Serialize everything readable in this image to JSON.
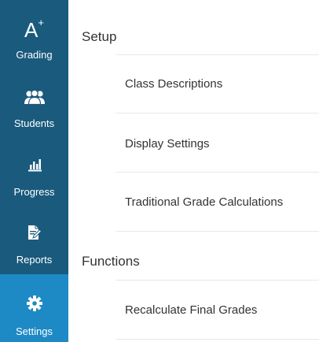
{
  "sidebar": {
    "items": [
      {
        "label": "Grading",
        "icon": "a-plus-icon",
        "active": false
      },
      {
        "label": "Students",
        "icon": "students-icon",
        "active": false
      },
      {
        "label": "Progress",
        "icon": "bar-chart-icon",
        "active": false
      },
      {
        "label": "Reports",
        "icon": "report-edit-icon",
        "active": false
      },
      {
        "label": "Settings",
        "icon": "gear-icon",
        "active": true
      }
    ],
    "grading_icon_glyph": "A",
    "grading_icon_sup": "+"
  },
  "sections": [
    {
      "title": "Setup",
      "items": [
        "Class Descriptions",
        "Display Settings",
        "Traditional Grade Calculations"
      ]
    },
    {
      "title": "Functions",
      "items": [
        "Recalculate Final Grades"
      ]
    }
  ],
  "colors": {
    "sidebar_bg": "#1a5a7d",
    "active_bg": "#1d8ac5",
    "text": "#333333",
    "divider": "#e8e8e8"
  }
}
